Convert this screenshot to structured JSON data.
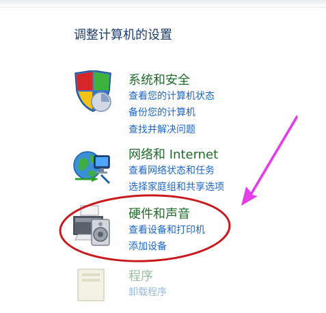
{
  "page_title": "调整计算机的设置",
  "categories": [
    {
      "title": "系统和安全",
      "icon": "shield-icon",
      "links": [
        "查看您的计算机状态",
        "备份您的计算机",
        "查找并解决问题"
      ]
    },
    {
      "title": "网络和 Internet",
      "icon": "network-globe-icon",
      "links": [
        "查看网络状态和任务",
        "选择家庭组和共享选项"
      ]
    },
    {
      "title": "硬件和声音",
      "icon": "printer-speaker-icon",
      "links": [
        "查看设备和打印机",
        "添加设备"
      ]
    },
    {
      "title": "程序",
      "icon": "programs-icon",
      "links": [
        "卸载程序"
      ]
    }
  ],
  "annotation": {
    "ellipse_color": "#c8181c",
    "arrow_color": "#e23fe6"
  }
}
